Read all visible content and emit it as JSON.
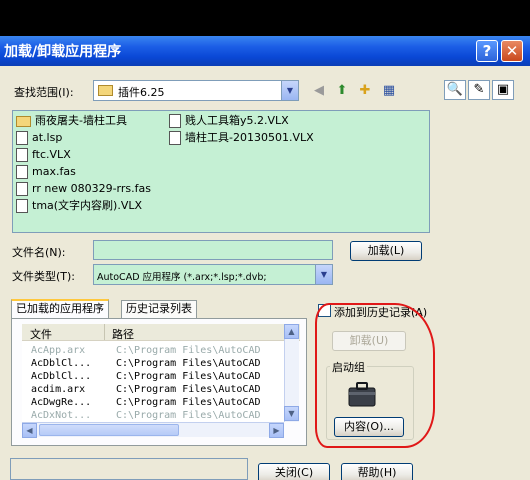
{
  "window": {
    "title": "加载/卸载应用程序",
    "help": "?",
    "close": "✕"
  },
  "lookin": {
    "label": "查找范围(I):",
    "value": "插件6.25"
  },
  "files": {
    "col1": [
      {
        "name": "雨夜屠夫-墙柱工具",
        "type": "folder"
      },
      {
        "name": "at.lsp",
        "type": "file"
      },
      {
        "name": "ftc.VLX",
        "type": "file"
      },
      {
        "name": "max.fas",
        "type": "file"
      },
      {
        "name": "rr new 080329-rrs.fas",
        "type": "file"
      },
      {
        "name": "tma(文字内容刷).VLX",
        "type": "file"
      }
    ],
    "col2": [
      {
        "name": "贱人工具箱y5.2.VLX",
        "type": "file"
      },
      {
        "name": "墙柱工具-20130501.VLX",
        "type": "file"
      }
    ]
  },
  "filename": {
    "label": "文件名(N):",
    "value": ""
  },
  "load_button": "加载(L)",
  "filetype": {
    "label": "文件类型(T):",
    "value": "AutoCAD 应用程序 (*.arx;*.lsp;*.dvb;"
  },
  "tabs": [
    "已加载的应用程序",
    "历史记录列表"
  ],
  "add_history": "添加到历史记录(A)",
  "loaded_list": {
    "headers": [
      "文件",
      "路径"
    ],
    "rows": [
      {
        "file": "AcApp.arx",
        "path": "C:\\Program Files\\AutoCAD",
        "muted": true
      },
      {
        "file": "AcDblCl...",
        "path": "C:\\Program Files\\AutoCAD",
        "muted": false
      },
      {
        "file": "AcDblCl...",
        "path": "C:\\Program Files\\AutoCAD",
        "muted": false
      },
      {
        "file": "acdim.arx",
        "path": "C:\\Program Files\\AutoCAD",
        "muted": false
      },
      {
        "file": "AcDwgRe...",
        "path": "C:\\Program Files\\AutoCAD",
        "muted": false
      },
      {
        "file": "AcDxNot...",
        "path": "C:\\Program Files\\AutoCAD",
        "muted": true
      }
    ]
  },
  "unload_button": "卸载(U)",
  "startup_suite": {
    "label": "启动组",
    "contents_button": "内容(O)..."
  },
  "close_button": "关闭(C)",
  "help_button": "帮助(H)"
}
